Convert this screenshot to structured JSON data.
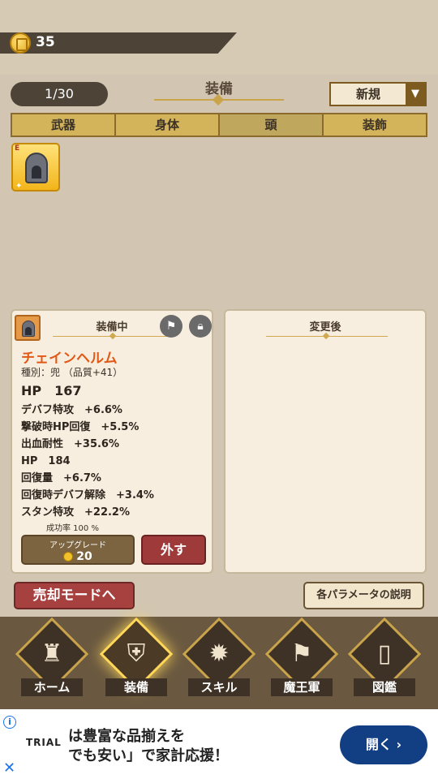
{
  "coins": "35",
  "inventory": {
    "counter": "1/30",
    "title": "装備",
    "sort": "新規",
    "sort_arrow": "▼"
  },
  "tabs": [
    {
      "label": "武器"
    },
    {
      "label": "身体"
    },
    {
      "label": "頭"
    },
    {
      "label": "装飾"
    }
  ],
  "slot": {
    "rank": "E"
  },
  "equipped": {
    "title": "装備中",
    "name": "チェインヘルム",
    "type": "種別：兜 （品質+41）",
    "main_stat": "HP　167",
    "stats": [
      "デバフ特攻　+6.6%",
      "撃破時HP回復　+5.5%",
      "出血耐性　+35.6%",
      "HP　184",
      "回復量　+6.7%",
      "回復時デバフ解除　+3.4%",
      "スタン特攻　+22.2%"
    ],
    "success": "成功率 100 %",
    "upgrade_label": "アップグレード",
    "upgrade_cost": "20",
    "remove_label": "外す"
  },
  "after": {
    "title": "変更後"
  },
  "buttons": {
    "sell": "売却モードへ",
    "params": "各パラメータの説明"
  },
  "nav": [
    {
      "label": "ホーム",
      "icon": "castle-icon"
    },
    {
      "label": "装備",
      "icon": "helmet-shield-icon"
    },
    {
      "label": "スキル",
      "icon": "skill-ring-icon"
    },
    {
      "label": "魔王軍",
      "icon": "flag-icon"
    },
    {
      "label": "図鑑",
      "icon": "book-icon"
    }
  ],
  "ad": {
    "brand": "TRIAL",
    "line1": "は豊富な品揃えを",
    "line2": "でも安い」で家計応援！",
    "cta": "開く",
    "cta_arrow": "›"
  },
  "colors": {
    "accent_gold": "#c9a44a",
    "name_orange": "#e05a17",
    "danger_red": "#a7413f",
    "ad_blue": "#123f83"
  }
}
